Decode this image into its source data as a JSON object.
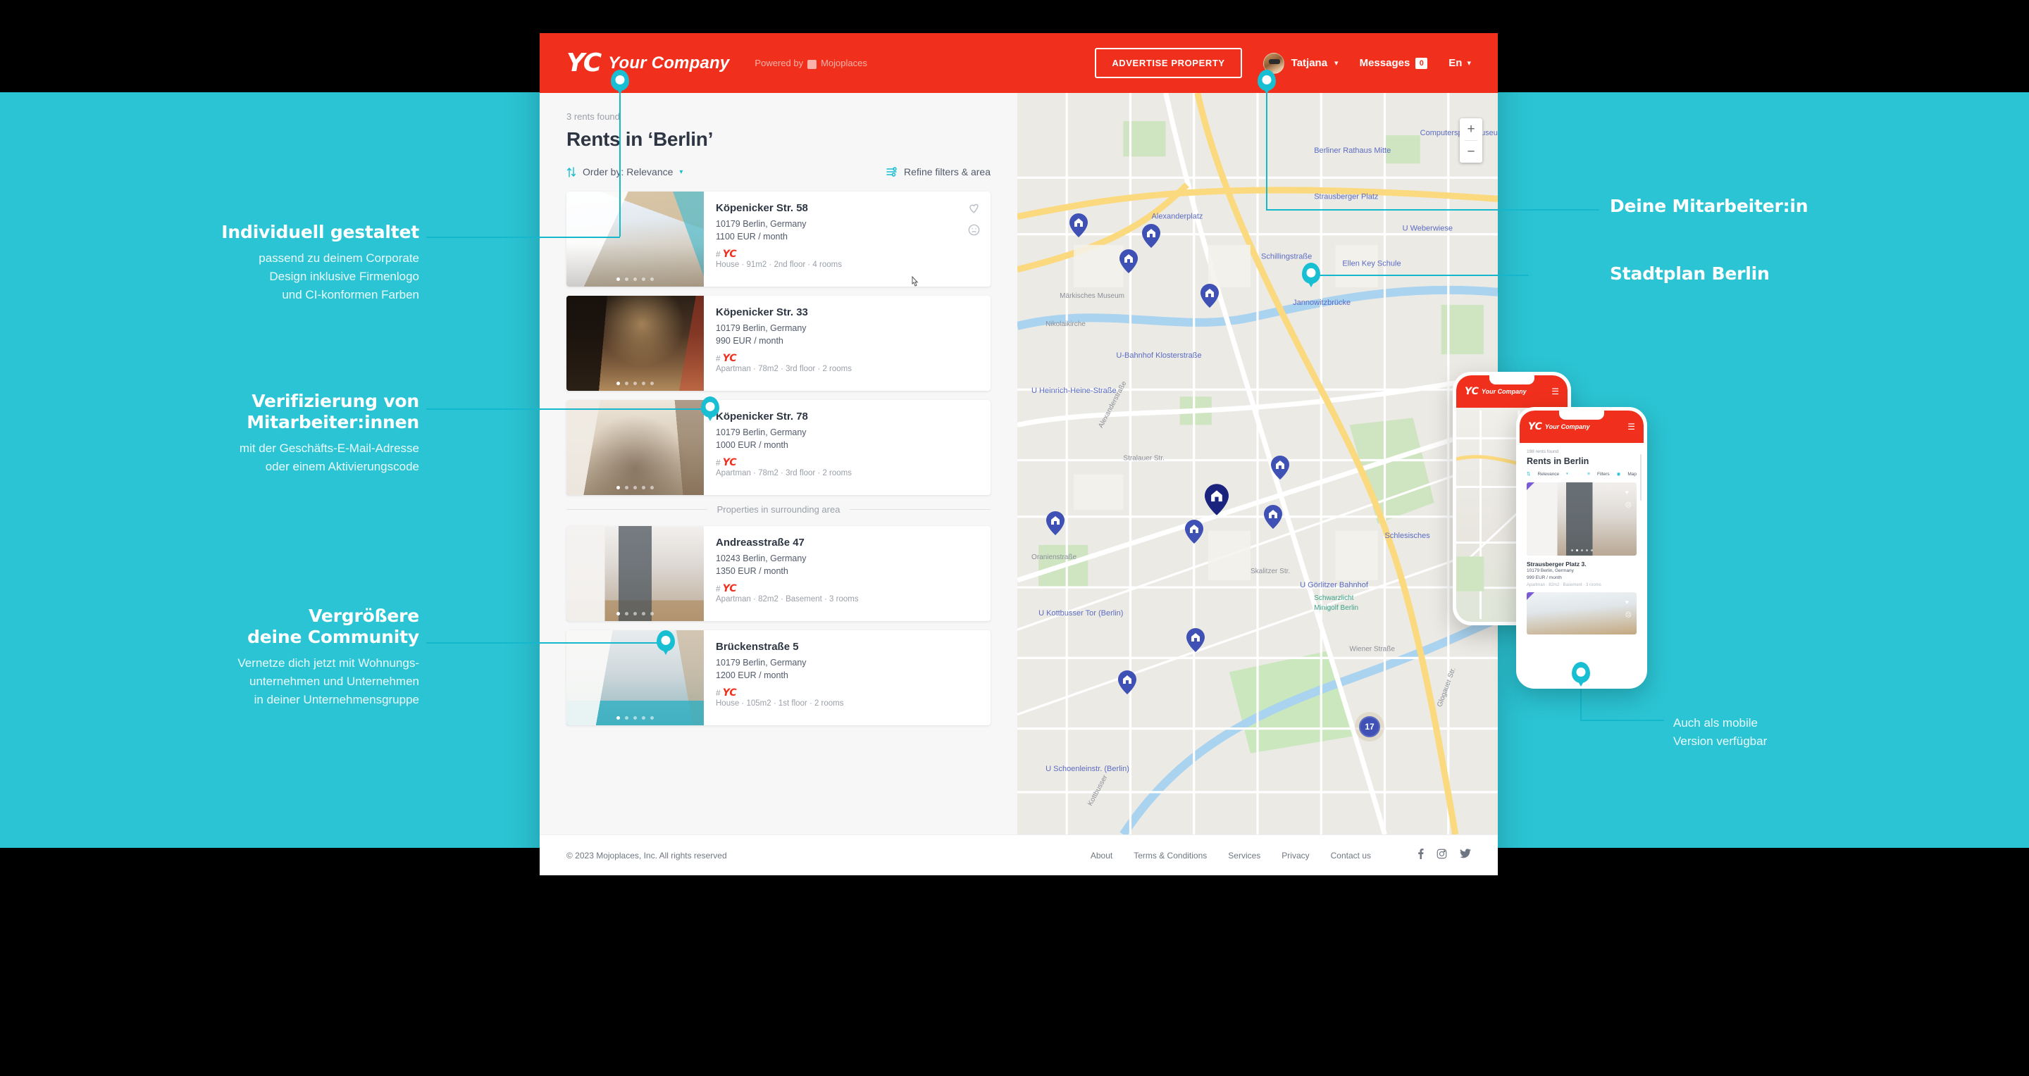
{
  "header": {
    "brand_mark": "YC",
    "brand_name": "Your Company",
    "powered_by": "Powered by",
    "powered_brand": "Mojoplaces",
    "advertise_button": "ADVERTISE PROPERTY",
    "user_name": "Tatjana",
    "messages_label": "Messages",
    "messages_count": "0",
    "language": "En",
    "accent_color": "#f0301d"
  },
  "results": {
    "count_label": "3 rents found",
    "title": "Rents in ‘Berlin’",
    "order_by": "Order by: Relevance",
    "refine": "Refine filters & area",
    "surrounding_divider": "Properties in surrounding area",
    "listings": [
      {
        "title": "Köpenicker Str. 58",
        "address": "10179 Berlin, Germany",
        "price": "1100 EUR / month",
        "tag_hash": "#",
        "tag_brand": "YC",
        "meta": "House · 91m2 · 2nd floor · 4 rooms"
      },
      {
        "title": "Köpenicker Str. 33",
        "address": "10179 Berlin, Germany",
        "price": "990 EUR / month",
        "tag_hash": "#",
        "tag_brand": "YC",
        "meta": "Apartman · 78m2 · 3rd floor · 2 rooms"
      },
      {
        "title": "Köpenicker Str. 78",
        "address": "10179 Berlin, Germany",
        "price": "1000 EUR / month",
        "tag_hash": "#",
        "tag_brand": "YC",
        "meta": "Apartman · 78m2 · 3rd floor · 2 rooms"
      },
      {
        "title": "Andreasstraße 47",
        "address": "10243 Berlin, Germany",
        "price": "1350 EUR / month",
        "tag_hash": "#",
        "tag_brand": "YC",
        "meta": "Apartman · 82m2 · Basement · 3 rooms"
      },
      {
        "title": "Brückenstraße 5",
        "address": "10179 Berlin, Germany",
        "price": "1200 EUR / month",
        "tag_hash": "#",
        "tag_brand": "YC",
        "meta": "House · 105m2 · 1st floor · 2 rooms"
      }
    ]
  },
  "map": {
    "zoom_in": "+",
    "zoom_out": "−",
    "cluster_count": "17",
    "labels": [
      "Alexanderplatz",
      "Schillingstraße",
      "U-Bahnhof Klosterstraße",
      "Alexanderstraße",
      "Stralauer Str.",
      "Oranienstraße",
      "Skalitzer Str.",
      "U Görlitzer Bahnhof",
      "Schwarzlicht Minigolf Berlin",
      "Wiener Straße",
      "Glogauer Str.",
      "Kottbusser",
      "Jannowitzbrücke",
      "U Heinrich-Heine-Straße",
      "Strausberger Platz",
      "U Weberwiese",
      "Ellen Key Schule",
      "Markisches Museum",
      "Nikolaikirche",
      "Schlesisches Tor",
      "U Schoenleinstr. (Berlin)",
      "Berliner Rathaus Mitte",
      "U Kottbusser Tor (Berlin)",
      "Computerspielemuseum"
    ]
  },
  "footer": {
    "copyright": "© 2023 Mojoplaces, Inc. All rights reserved",
    "links": [
      "About",
      "Terms & Conditions",
      "Services",
      "Privacy",
      "Contact us"
    ],
    "socials": [
      "facebook-icon",
      "instagram-icon",
      "twitter-icon"
    ]
  },
  "annotations": {
    "teal_color": "#2bc4d4",
    "left": [
      {
        "heading": "Individuell gestaltet",
        "body": "passend zu deinem Corporate\nDesign inklusive Firmenlogo\nund CI-konformen Farben"
      },
      {
        "heading": "Verifizierung von\nMitarbeiter:innen",
        "body": "mit der Geschäfts-E-Mail-Adresse\noder einem Aktivierungscode"
      },
      {
        "heading": "Vergrößere\ndeine Community",
        "body": "Vernetze dich jetzt mit Wohnungs-\nunternehmen und Unternehmen\nin deiner Unternehmensgruppe"
      }
    ],
    "right": [
      {
        "heading": "Deine Mitarbeiter:in",
        "body": ""
      },
      {
        "heading": "Stadtplan Berlin",
        "body": ""
      },
      {
        "heading": "",
        "body": "Auch als mobile\nVersion verfügbar"
      }
    ]
  },
  "phone": {
    "brand_mark": "YC",
    "brand_name": "Your Company",
    "count_label": "198 rents found",
    "title": "Rents in Berlin",
    "order_by": "Relevance",
    "filters": "Filters",
    "map_toggle": "Map",
    "listing": {
      "title": "Strausberger Platz 3.",
      "address": "10179 Berlin, Germany",
      "price": "999 EUR / month",
      "meta": "Apartman · 82m2 · Basement · 3 rooms"
    }
  }
}
